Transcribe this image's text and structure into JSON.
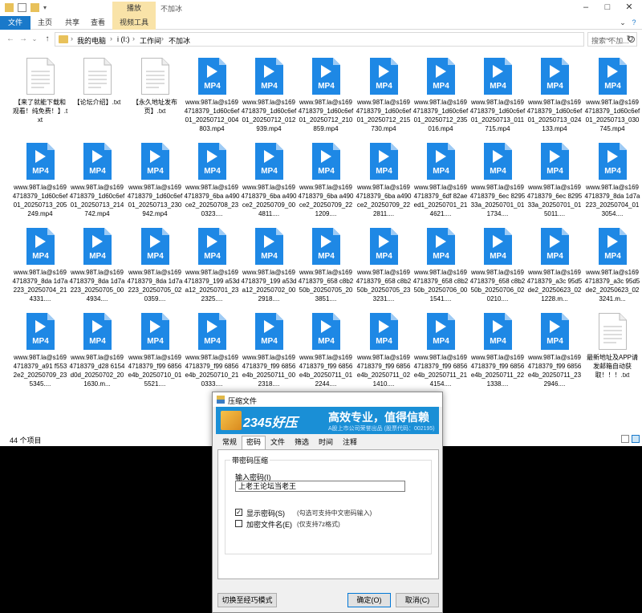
{
  "explorer": {
    "window_title": "不加冰",
    "context_tab": "播放",
    "tabs": [
      "文件",
      "主页",
      "共享",
      "查看",
      "视频工具"
    ],
    "breadcrumb": [
      "我的电脑",
      "i (I:)",
      "工作间",
      "不加冰"
    ],
    "search_placeholder": "搜索\"不加...",
    "status": "44 个项目",
    "files": [
      {
        "type": "txt",
        "name": "【来了就能下载和观看！纯免费！】.txt"
      },
      {
        "type": "txt",
        "name": "【论坛介绍】.txt"
      },
      {
        "type": "txt",
        "name": "【永久地址发布页】.txt"
      },
      {
        "type": "mp4",
        "name": "www.98T.la@s1694718379_1d60c6ef01_20250712_004803.mp4"
      },
      {
        "type": "mp4",
        "name": "www.98T.la@s1694718379_1d60c6ef01_20250712_012939.mp4"
      },
      {
        "type": "mp4",
        "name": "www.98T.la@s1694718379_1d60c6ef01_20250712_210859.mp4"
      },
      {
        "type": "mp4",
        "name": "www.98T.la@s1694718379_1d60c6ef01_20250712_215730.mp4"
      },
      {
        "type": "mp4",
        "name": "www.98T.la@s1694718379_1d60c6ef01_20250712_235016.mp4"
      },
      {
        "type": "mp4",
        "name": "www.98T.la@s1694718379_1d60c6ef01_20250713_011715.mp4"
      },
      {
        "type": "mp4",
        "name": "www.98T.la@s1694718379_1d60c6ef01_20250713_024133.mp4"
      },
      {
        "type": "mp4",
        "name": "www.98T.la@s1694718379_1d60c6ef01_20250713_030745.mp4"
      },
      {
        "type": "mp4",
        "name": "www.98T.la@s1694718379_1d60c6ef01_20250713_205249.mp4"
      },
      {
        "type": "mp4",
        "name": "www.98T.la@s1694718379_1d60c6ef01_20250713_214742.mp4"
      },
      {
        "type": "mp4",
        "name": "www.98T.la@s1694718379_1d60c6ef01_20250713_230942.mp4"
      },
      {
        "type": "mp4",
        "name": "www.98T.la@s1694718379_6ba a490ce2_20250708_230323...."
      },
      {
        "type": "mp4",
        "name": "www.98T.la@s1694718379_6ba a490ce2_20250709_004811...."
      },
      {
        "type": "mp4",
        "name": "www.98T.la@s1694718379_6ba a490ce2_20250709_221209...."
      },
      {
        "type": "mp4",
        "name": "www.98T.la@s1694718379_6ba a490ce2_20250709_222811...."
      },
      {
        "type": "mp4",
        "name": "www.98T.la@s1694718379_6df 82aeed1_20250701_214621...."
      },
      {
        "type": "mp4",
        "name": "www.98T.la@s1694718379_6ec 829533a_20250701_011734...."
      },
      {
        "type": "mp4",
        "name": "www.98T.la@s1694718379_6ec 829533a_20250701_015011...."
      },
      {
        "type": "mp4",
        "name": "www.98T.la@s1694718379_8da 1d7a223_20250704_013054...."
      },
      {
        "type": "mp4",
        "name": "www.98T.la@s1694718379_8da 1d7a223_20250704_214331...."
      },
      {
        "type": "mp4",
        "name": "www.98T.la@s1694718379_8da 1d7a223_20250705_004934...."
      },
      {
        "type": "mp4",
        "name": "www.98T.la@s1694718379_8da 1d7a223_20250705_020359...."
      },
      {
        "type": "mp4",
        "name": "www.98T.la@s1694718379_199 a53da12_20250701_232325...."
      },
      {
        "type": "mp4",
        "name": "www.98T.la@s1694718379_199 a53da12_20250702_002918...."
      },
      {
        "type": "mp4",
        "name": "www.98T.la@s1694718379_658 c8b250b_20250705_203851...."
      },
      {
        "type": "mp4",
        "name": "www.98T.la@s1694718379_658 c8b250b_20250705_233231...."
      },
      {
        "type": "mp4",
        "name": "www.98T.la@s1694718379_658 c8b250b_20250706_001541...."
      },
      {
        "type": "mp4",
        "name": "www.98T.la@s1694718379_658 c8b250b_20250706_020210...."
      },
      {
        "type": "mp4",
        "name": "www.98T.la@s1694718379_a3c 95d5de2_20250623_021228.m..."
      },
      {
        "type": "mp4",
        "name": "www.98T.la@s1694718379_a3c 95d5de2_20250623_023241.m..."
      },
      {
        "type": "mp4",
        "name": "www.98T.la@s1694718379_a91 f5532e2_20250709_235345...."
      },
      {
        "type": "mp4",
        "name": "www.98T.la@s1694718379_d28 6154d0d_20250702_201630.m..."
      },
      {
        "type": "mp4",
        "name": "www.98T.la@s1694718379_f99 6856e4b_20250710_015521...."
      },
      {
        "type": "mp4",
        "name": "www.98T.la@s1694718379_f99 6856e4b_20250710_210333...."
      },
      {
        "type": "mp4",
        "name": "www.98T.la@s1694718379_f99 6856e4b_20250711_002318...."
      },
      {
        "type": "mp4",
        "name": "www.98T.la@s1694718379_f99 6856e4b_20250711_012244...."
      },
      {
        "type": "mp4",
        "name": "www.98T.la@s1694718379_f99 6856e4b_20250711_021410...."
      },
      {
        "type": "mp4",
        "name": "www.98T.la@s1694718379_f99 6856e4b_20250711_214154...."
      },
      {
        "type": "mp4",
        "name": "www.98T.la@s1694718379_f99 6856e4b_20250711_221338...."
      },
      {
        "type": "mp4",
        "name": "www.98T.la@s1694718379_f99 6856e4b_20250711_232946...."
      },
      {
        "type": "txt",
        "name": "最新地址及APP请发邮箱自动获取！！！.txt"
      }
    ],
    "mp4_badge": "MP4",
    "accent": "#1979ca",
    "mp4_color": "#1e88e5"
  },
  "dialog": {
    "title": "压缩文件",
    "banner_logo": "2345好压",
    "banner_slogan": "高效专业，值得信赖",
    "banner_sub": "A股上市公司荣誉出品 (股票代码：002195)",
    "tabs": [
      "常规",
      "密码",
      "文件",
      "筛选",
      "时间",
      "注释"
    ],
    "active_tab": "密码",
    "group_title": "带密码压缩",
    "password_label": "输入密码(I)",
    "password_value": "上老王论坛当老王",
    "show_password_label": "显示密码(S)",
    "show_password_hint": "(勾选可支持中文密码输入)",
    "show_password_checked": true,
    "encrypt_names_label": "加密文件名(E)",
    "encrypt_names_hint": "(仅支持7z格式)",
    "encrypt_names_checked": false,
    "classic_button": "切换至经巧模式",
    "ok_button": "确定(O)",
    "cancel_button": "取消(C)"
  }
}
